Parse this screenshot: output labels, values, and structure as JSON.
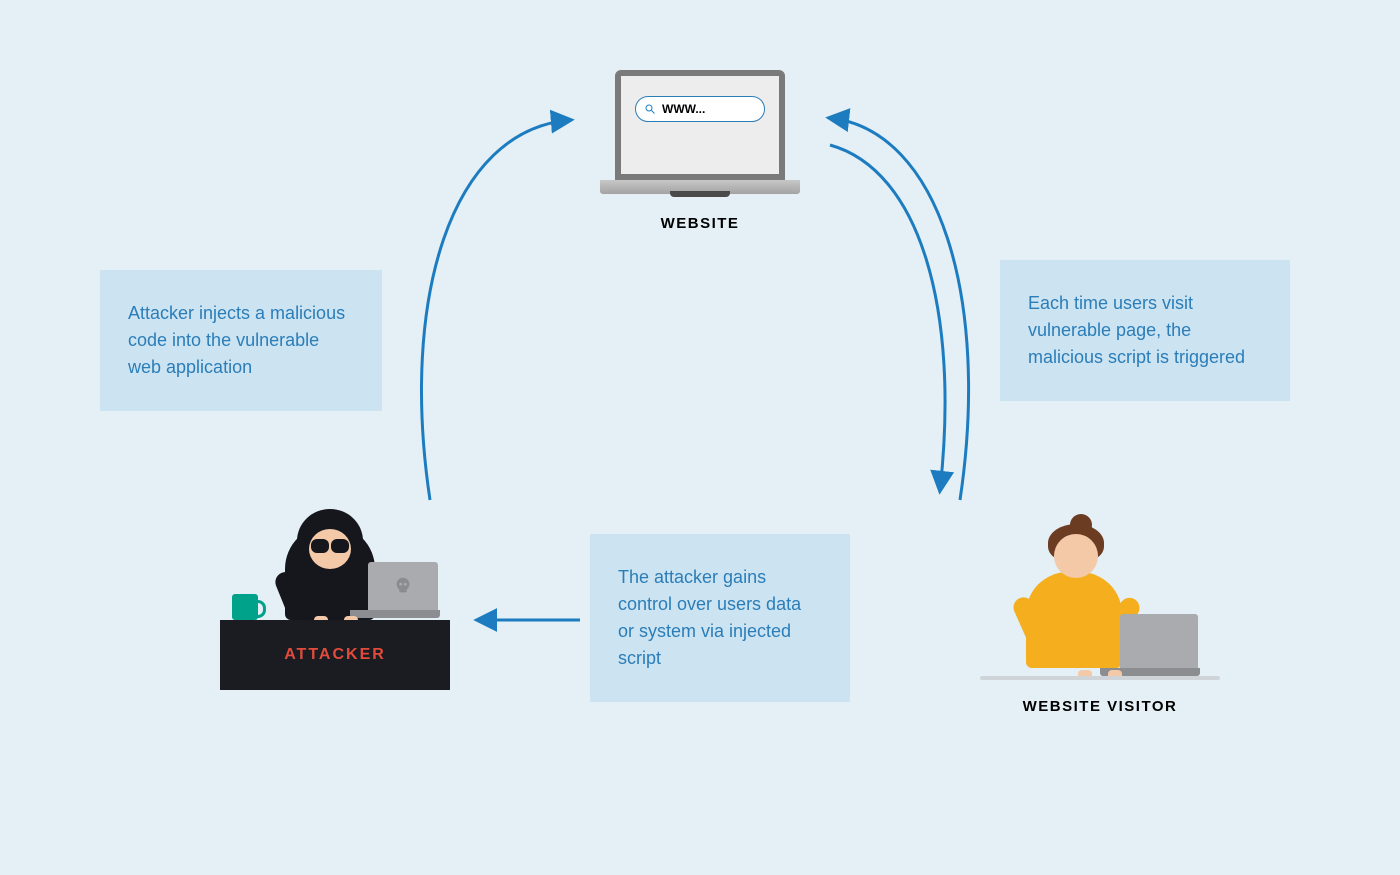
{
  "nodes": {
    "website_label": "WEBSITE",
    "attacker_label": "ATTACKER",
    "visitor_label": "WEBSITE VISITOR",
    "url_text": "WWW..."
  },
  "boxes": {
    "step1": "Attacker injects a malicious code into the vulnerable web application",
    "step2": "Each time users visit vulnerable page, the malicious script is triggered",
    "step3": "The attacker gains control over users data or system via injected script"
  },
  "colors": {
    "arrow": "#1d7cc0",
    "box_bg": "#cce4f2",
    "box_text": "#2b7db8",
    "page_bg": "#e4f0f6",
    "attacker_accent": "#e24b3b"
  }
}
